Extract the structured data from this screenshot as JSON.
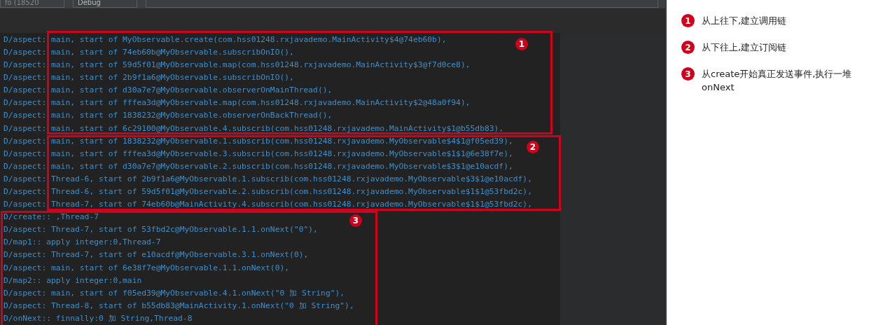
{
  "toolbar": {
    "process_dropdown": "fo (18520",
    "level_dropdown": "Debug"
  },
  "log_groups": [
    {
      "badge": "1",
      "lines": [
        "D/aspect: main, start of MyObservable.create(com.hss01248.rxjavademo.MainActivity$4@74eb60b),",
        "D/aspect: main, start of 74eb60b@MyObservable.subscribOnIO(),",
        "D/aspect: main, start of 59d5f01@MyObservable.map(com.hss01248.rxjavademo.MainActivity$3@f7d0ce8),",
        "D/aspect: main, start of 2b9f1a6@MyObservable.subscribOnIO(),",
        "D/aspect: main, start of d30a7e7@MyObservable.observerOnMainThread(),",
        "D/aspect: main, start of fffea3d@MyObservable.map(com.hss01248.rxjavademo.MainActivity$2@48a0f94),",
        "D/aspect: main, start of 1838232@MyObservable.observerOnBackThread(),",
        "D/aspect: main, start of 6c29100@MyObservable.4.subscrib(com.hss01248.rxjavademo.MainActivity$1@b55db83),"
      ]
    },
    {
      "badge": "2",
      "lines": [
        "D/aspect: main, start of 1838232@MyObservable.1.subscrib(com.hss01248.rxjavademo.MyObservable$4$1@f05ed39),",
        "D/aspect: main, start of fffea3d@MyObservable.3.subscrib(com.hss01248.rxjavademo.MyObservable$1$1@6e38f7e),",
        "D/aspect: main, start of d30a7e7@MyObservable.2.subscrib(com.hss01248.rxjavademo.MyObservable$3$1@e10acdf),",
        "D/aspect: Thread-6, start of 2b9f1a6@MyObservable.1.subscrib(com.hss01248.rxjavademo.MyObservable$3$1@e10acdf),",
        "D/aspect: Thread-6, start of 59d5f01@MyObservable.2.subscrib(com.hss01248.rxjavademo.MyObservable$1$1@53fbd2c),",
        "D/aspect: Thread-7, start of 74eb60b@MainActivity.4.subscrib(com.hss01248.rxjavademo.MyObservable$1$1@53fbd2c),"
      ]
    },
    {
      "badge": "3",
      "lines": [
        "D/create:: ,Thread-7",
        "D/aspect: Thread-7, start of 53fbd2c@MyObservable.1.1.onNext(\"0\"),",
        "D/map1:: apply integer:0,Thread-7",
        "D/aspect: Thread-7, start of e10acdf@MyObservable.3.1.onNext(0),",
        "D/aspect: main, start of 6e38f7e@MyObservable.1.1.onNext(0),",
        "D/map2:: apply integer:0,main",
        "D/aspect: main, start of f05ed39@MyObservable.4.1.onNext(\"0 加 String\"),",
        "D/aspect: Thread-8, start of b55db83@MainActivity.1.onNext(\"0 加 String\"),",
        "D/onNext:: finnally:0 加 String,Thread-8"
      ]
    }
  ],
  "notes": [
    {
      "badge": "1",
      "text": "从上往下,建立调用链"
    },
    {
      "badge": "2",
      "text": "从下往上,建立订阅链"
    },
    {
      "badge": "3",
      "text": "从create开始真正发送事件,执行一堆onNext"
    }
  ]
}
